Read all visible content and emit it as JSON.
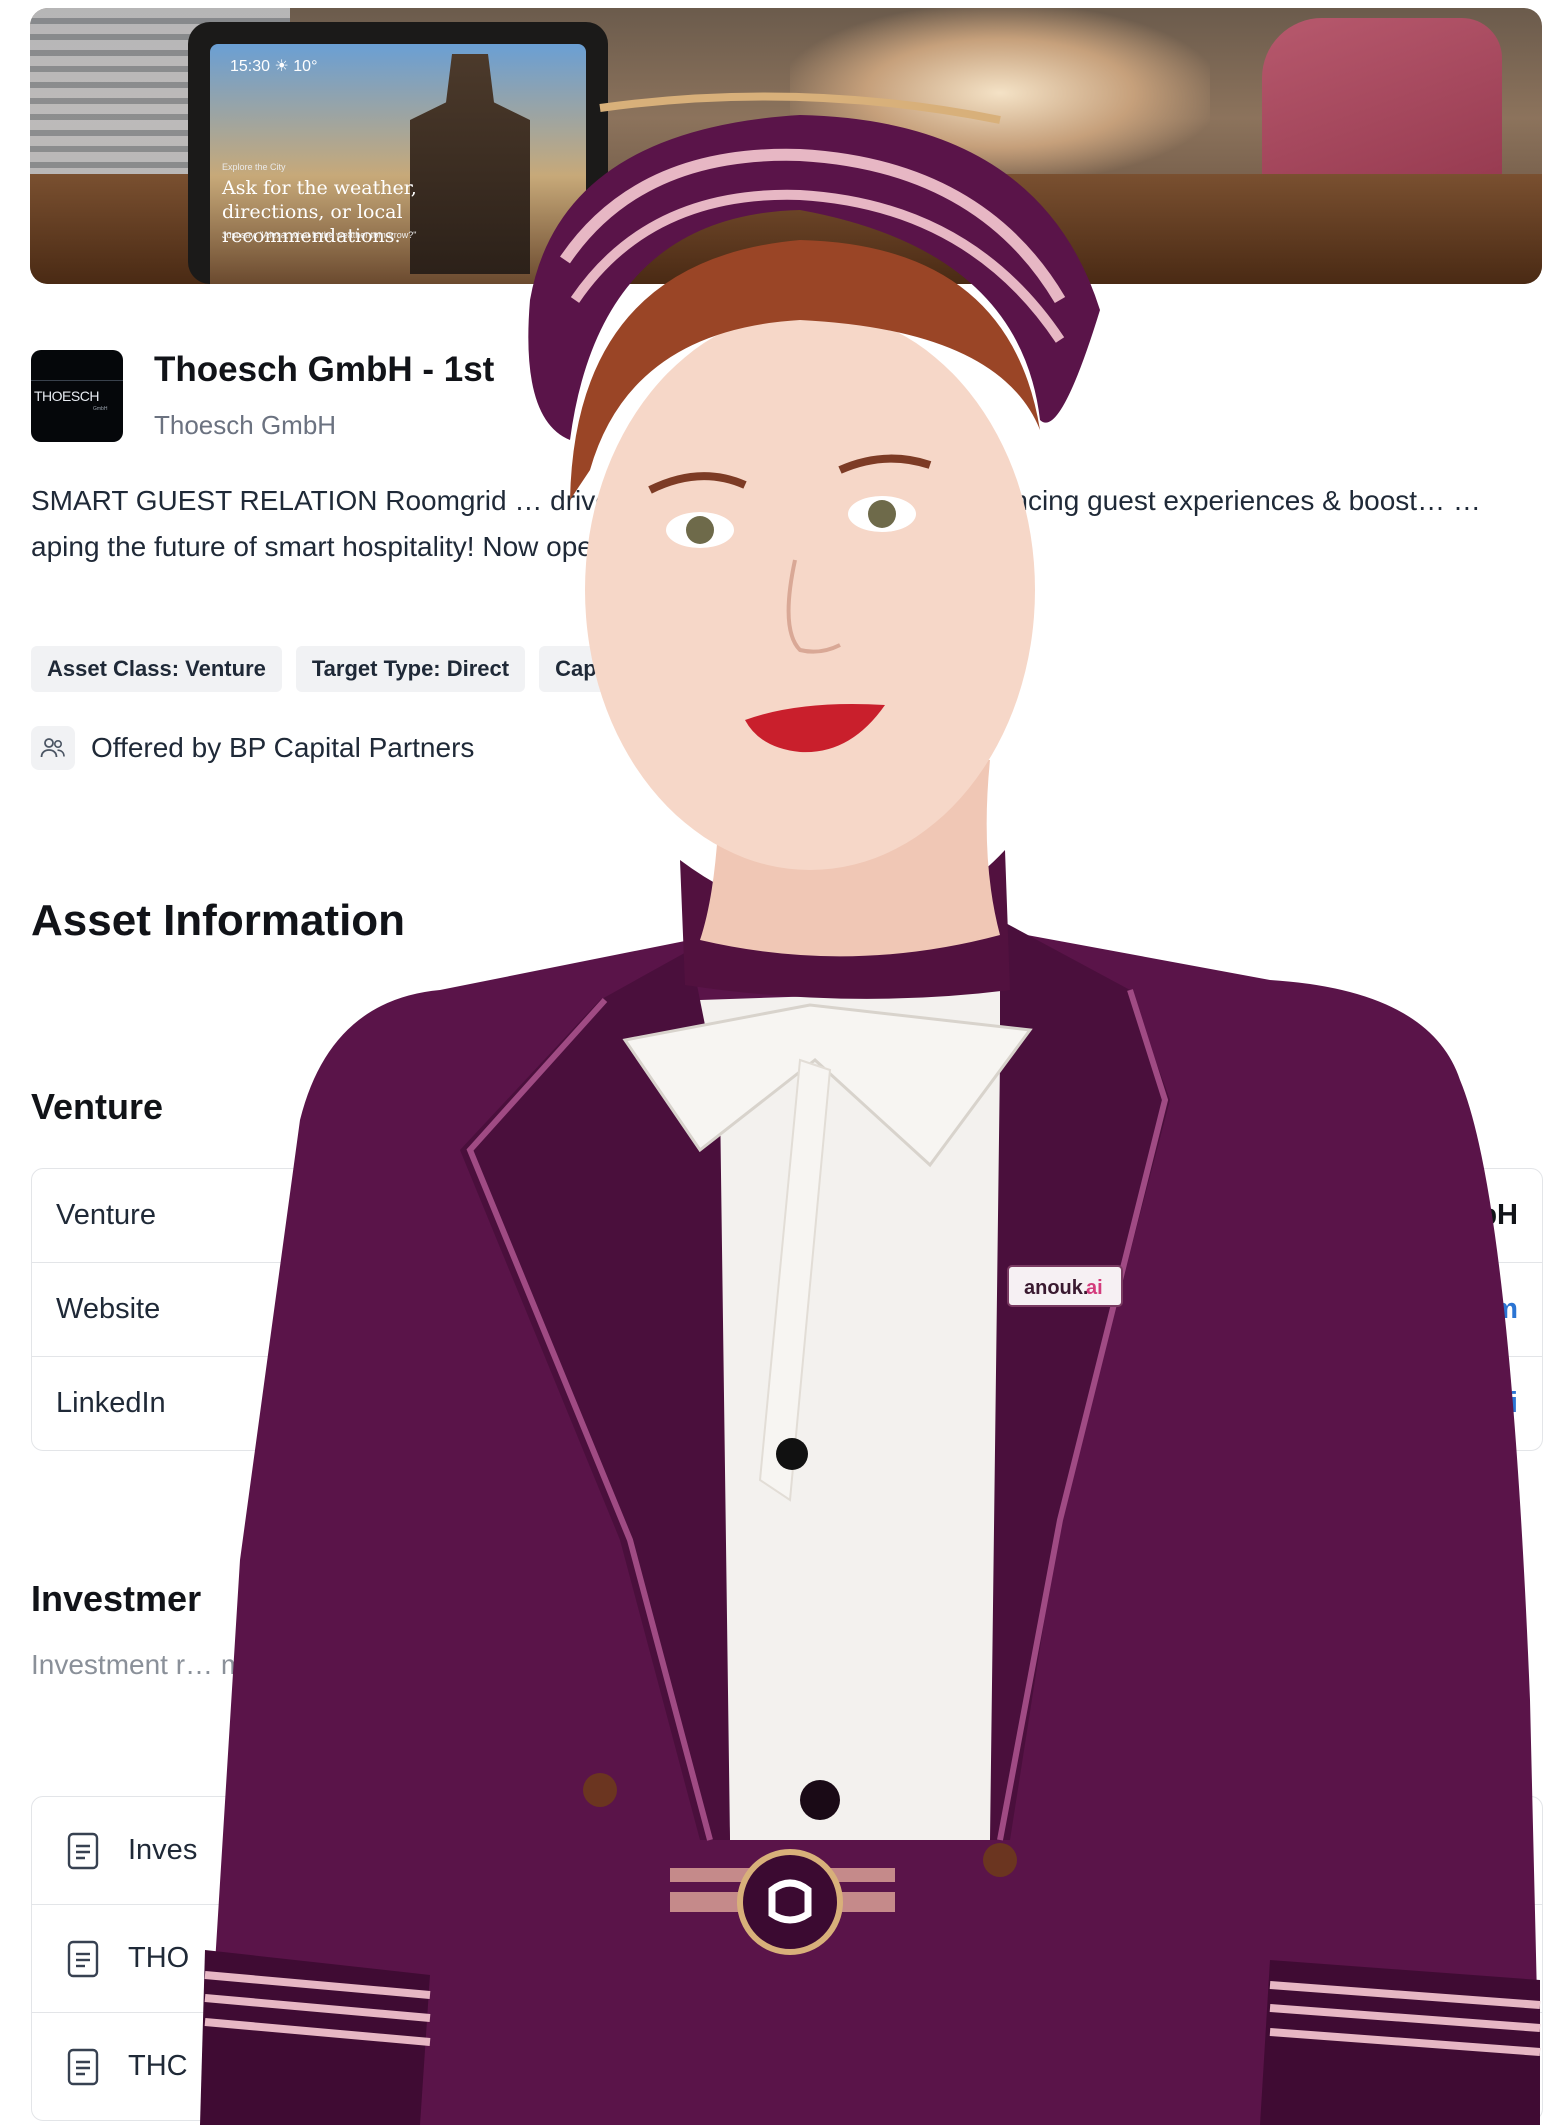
{
  "hero": {
    "device_time": "15:30 ☀ 10°",
    "device_kicker": "Explore the City",
    "device_headline": "Ask for the weather, directions, or local recommendations.",
    "device_hint": "Just say: \"Alexa, what is the weather tomorrow?\""
  },
  "offering": {
    "logo_text": "THOESCH",
    "logo_subtext": "GmbH",
    "title": "Thoesch GmbH - 1st",
    "issuer": "Thoesch GmbH",
    "description": "SMART GUEST RELATION Roomgrid … driven in-room voice assistants, enhancing guest experiences & boost… …aping the future of smart hospitality! Now open for investments",
    "tags": [
      "Asset Class: Venture",
      "Target Type: Direct",
      "Capi"
    ],
    "offered_by": "Offered by BP Capital Partners"
  },
  "asset_information": {
    "heading": "Asset Information",
    "venture_heading": "Venture",
    "rows": [
      {
        "key": "Venture",
        "value": "GmbH"
      },
      {
        "key": "Website",
        "value": "com"
      },
      {
        "key": "LinkedIn",
        "value": "l-ai"
      }
    ]
  },
  "investment": {
    "heading": "Investmer",
    "description": "Investment r… may include… historical pe…",
    "documents": [
      {
        "label": "Inves"
      },
      {
        "label": "THO"
      },
      {
        "label": "THC"
      }
    ]
  },
  "overlay": {
    "badge_text": "anouk.",
    "badge_accent": "ai",
    "colors": {
      "jacket": "#5a1449",
      "jacket_dark": "#3f0b33",
      "blouse": "#f3f1ee",
      "trim": "#e7b7c4",
      "link": "#2b74d3"
    }
  }
}
